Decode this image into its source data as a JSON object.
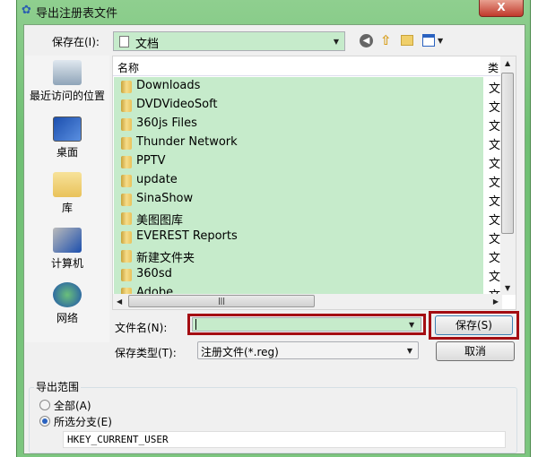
{
  "window": {
    "title": "导出注册表文件",
    "close_label": "X"
  },
  "lookin": {
    "label": "保存在(I):",
    "value": "文档"
  },
  "sidebar": {
    "items": [
      {
        "label": "最近访问的位置",
        "icon": "recent-places-icon"
      },
      {
        "label": "桌面",
        "icon": "desktop-icon"
      },
      {
        "label": "库",
        "icon": "libraries-icon"
      },
      {
        "label": "计算机",
        "icon": "computer-icon"
      },
      {
        "label": "网络",
        "icon": "network-icon"
      }
    ]
  },
  "list": {
    "columns": [
      "名称",
      "类"
    ],
    "rows": [
      {
        "name": "Downloads",
        "type": "文"
      },
      {
        "name": "DVDVideoSoft",
        "type": "文"
      },
      {
        "name": "360js Files",
        "type": "文"
      },
      {
        "name": "Thunder Network",
        "type": "文"
      },
      {
        "name": "PPTV",
        "type": "文"
      },
      {
        "name": "update",
        "type": "文"
      },
      {
        "name": "SinaShow",
        "type": "文"
      },
      {
        "name": "美图图库",
        "type": "文"
      },
      {
        "name": "EVEREST Reports",
        "type": "文"
      },
      {
        "name": "新建文件夹",
        "type": "文"
      },
      {
        "name": "360sd",
        "type": "文"
      },
      {
        "name": "Adobe",
        "type": "文"
      }
    ]
  },
  "filename": {
    "label": "文件名(N):",
    "value": ""
  },
  "filetype": {
    "label": "保存类型(T):",
    "value": "注册文件(*.reg)"
  },
  "buttons": {
    "save": "保存(S)",
    "cancel": "取消"
  },
  "export_range": {
    "title": "导出范围",
    "all": "全部(A)",
    "selected": "所选分支(E)",
    "selected_checked": true,
    "branch": "HKEY_CURRENT_USER"
  },
  "colors": {
    "highlight": "#c6ebcb",
    "annotation_red": "#a40d12"
  }
}
